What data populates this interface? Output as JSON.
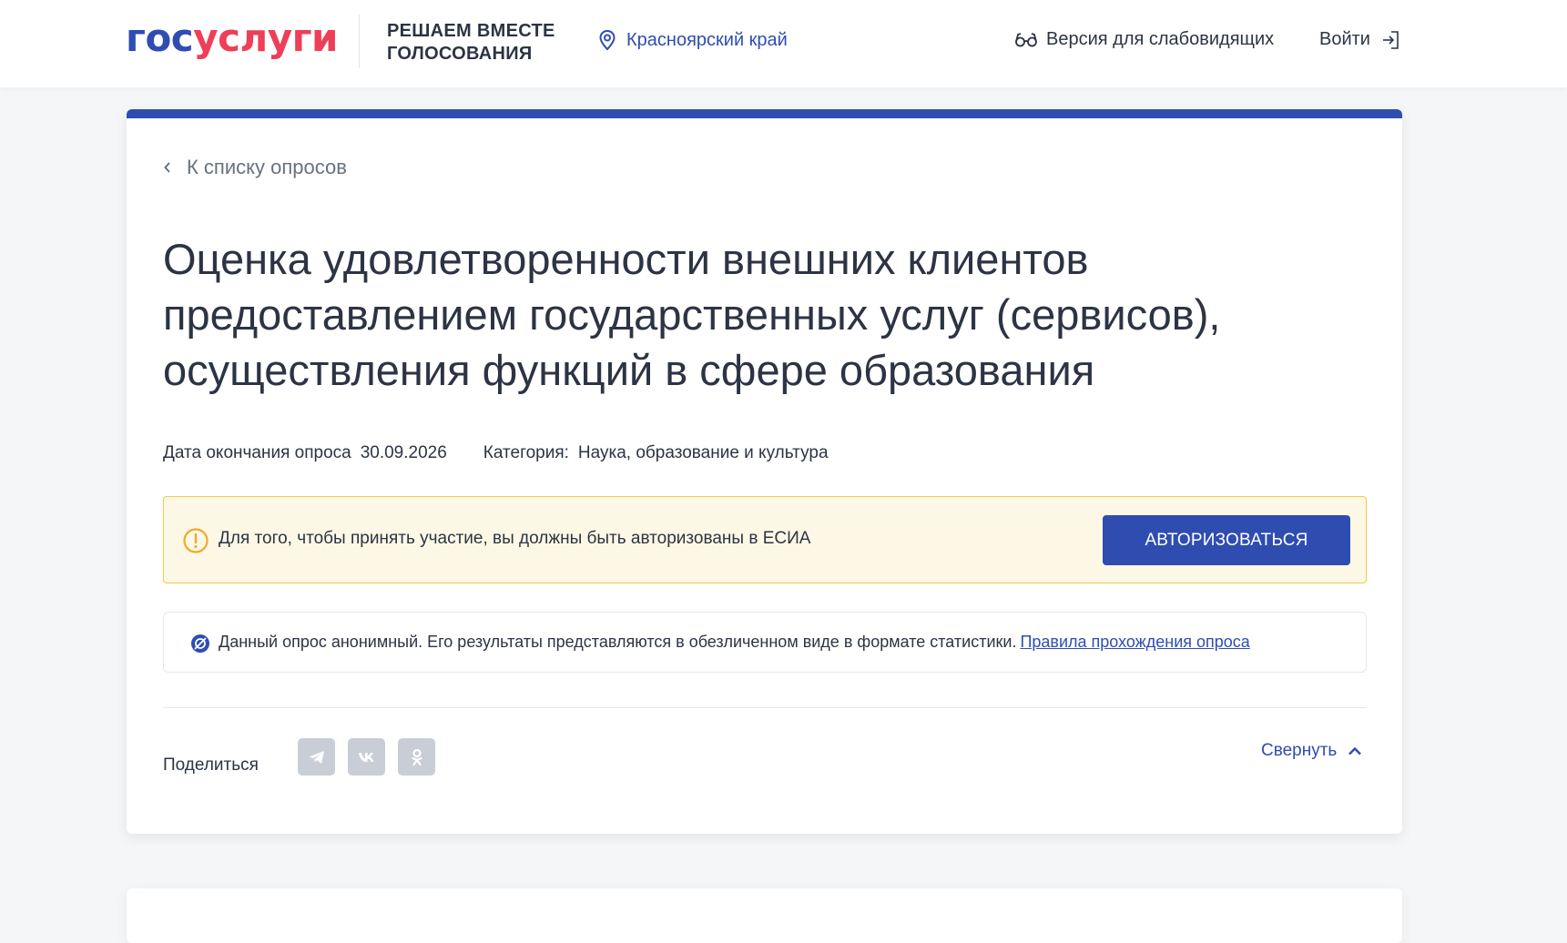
{
  "header": {
    "logo_part1": "гос",
    "logo_part2": "услуги",
    "project_line1": "РЕШАЕМ ВМЕСТЕ",
    "project_line2": "ГОЛОСОВАНИЯ",
    "region": "Красноярский край",
    "vision_label": "Версия для слабовидящих",
    "login_label": "Войти"
  },
  "card": {
    "back_label": "К списку опросов",
    "title": "Оценка удовлетворенности внешних клиентов предоставлением государственных услуг (сервисов), осуществления функций в сфере образования",
    "end_date_label": "Дата окончания опроса",
    "end_date_value": "30.09.2026",
    "category_label": "Категория:",
    "category_value": "Наука, образование и культура",
    "alert": {
      "text": "Для того, чтобы принять участие, вы должны быть авторизованы в ЕСИА",
      "button_label": "АВТОРИЗОВАТЬСЯ"
    },
    "info": {
      "text": "Данный опрос анонимный. Его результаты представляются в обезличенном виде в формате статистики.",
      "link_label": "Правила прохождения опроса"
    },
    "share_label": "Поделиться",
    "share_icons": [
      "telegram-icon",
      "vk-icon",
      "odnoklassniki-icon"
    ],
    "collapse_label": "Свернуть"
  },
  "colors": {
    "brand_blue": "#2f4db1",
    "brand_red": "#ee3f58",
    "alert_bg": "#fdf8e6",
    "alert_border": "#f2c94c",
    "share_gray": "#c9ced6"
  }
}
